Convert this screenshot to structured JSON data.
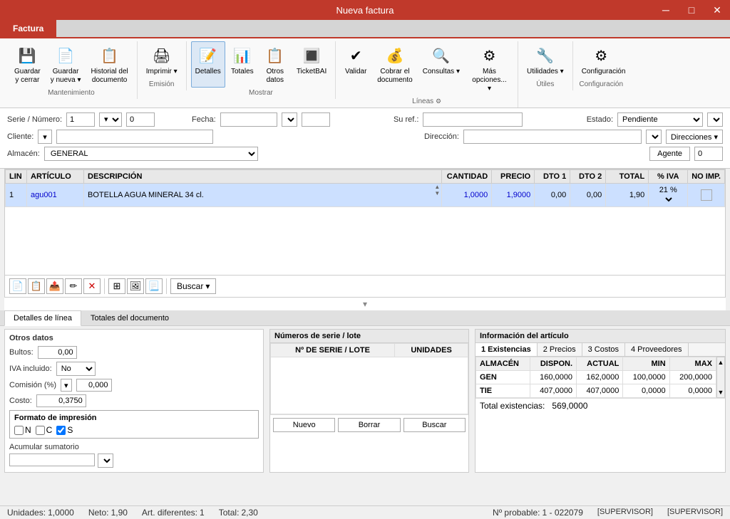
{
  "titleBar": {
    "title": "Nueva factura",
    "minimize": "─",
    "maximize": "□",
    "close": "✕"
  },
  "tab": {
    "label": "Factura"
  },
  "ribbon": {
    "sections": [
      {
        "name": "Mantenimiento",
        "buttons": [
          {
            "id": "guardar-cerrar",
            "label": "Guardar\ny cerrar",
            "icon": "💾"
          },
          {
            "id": "guardar-nueva",
            "label": "Guardar\ny nueva",
            "icon": "📄",
            "dropdown": true
          },
          {
            "id": "historial",
            "label": "Historial del\ndocumento",
            "icon": "📋"
          }
        ]
      },
      {
        "name": "Emisión",
        "buttons": [
          {
            "id": "imprimir",
            "label": "Imprimir",
            "icon": "🖨",
            "dropdown": true
          }
        ]
      },
      {
        "name": "Mostrar",
        "buttons": [
          {
            "id": "detalles",
            "label": "Detalles",
            "icon": "📝",
            "active": true
          },
          {
            "id": "totales",
            "label": "Totales",
            "icon": "📊"
          },
          {
            "id": "otros-datos",
            "label": "Otros\ndatos",
            "icon": "📋"
          },
          {
            "id": "ticketbai",
            "label": "TicketBAI",
            "icon": "🔳"
          }
        ]
      },
      {
        "name": "Líneas",
        "buttons": [
          {
            "id": "validar",
            "label": "Validar",
            "icon": "✔"
          },
          {
            "id": "cobrar",
            "label": "Cobrar el\ndocumento",
            "icon": "💰"
          },
          {
            "id": "consultas",
            "label": "Consultas",
            "icon": "🔍",
            "dropdown": true
          },
          {
            "id": "mas-opciones",
            "label": "Más\nopciones...",
            "icon": "⚙",
            "dropdown": true
          }
        ]
      },
      {
        "name": "Útiles",
        "buttons": [
          {
            "id": "utilidades",
            "label": "Utilidades",
            "icon": "🔧",
            "dropdown": true
          }
        ]
      },
      {
        "name": "Configuración",
        "buttons": [
          {
            "id": "configuracion",
            "label": "Configuración",
            "icon": "⚙"
          }
        ]
      }
    ]
  },
  "form": {
    "serieLabel": "Serie / Número:",
    "serieValue": "1",
    "numeroValue": "0",
    "fechaLabel": "Fecha:",
    "suRefLabel": "Su ref.:",
    "estadoLabel": "Estado:",
    "estadoValue": "Pendiente",
    "clienteLabel": "Cliente:",
    "direccionLabel": "Dirección:",
    "almacenLabel": "Almacén:",
    "almacenValue": "GENERAL",
    "agenteLabel": "Agente",
    "agenteValue": "0"
  },
  "table": {
    "columns": [
      "LIN",
      "ARTÍCULO",
      "DESCRIPCIÓN",
      "CANTIDAD",
      "PRECIO",
      "DTO 1",
      "DTO 2",
      "TOTAL",
      "% IVA",
      "NO IMP."
    ],
    "rows": [
      {
        "lin": "1",
        "articulo": "agu001",
        "descripcion": "BOTELLA AGUA MINERAL 34 cl.",
        "cantidad": "1,0000",
        "precio": "1,9000",
        "dto1": "0,00",
        "dto2": "0,00",
        "total": "1,90",
        "iva": "21 %",
        "noimp": ""
      }
    ]
  },
  "toolbar": {
    "buttons": [
      "📄",
      "📋",
      "📤",
      "✏",
      "✕",
      "🖼",
      "📷",
      "📃"
    ],
    "buscar": "Buscar"
  },
  "detailTabs": [
    {
      "id": "detalles-linea",
      "label": "Detalles de línea",
      "active": true
    },
    {
      "id": "totales-documento",
      "label": "Totales del documento",
      "active": false
    }
  ],
  "lineDetails": {
    "sectionTitle": "Otros datos",
    "bultosLabel": "Bultos:",
    "bultosValue": "0,00",
    "ivaIncluidoLabel": "IVA incluido:",
    "ivaIncluidoValue": "No",
    "costoLabel": "Costo:",
    "costoValue": "0,3750",
    "comisionLabel": "Comisión (%)",
    "comisionValue": "0,000",
    "printFormat": {
      "title": "Formato de impresión",
      "n": {
        "label": "N",
        "checked": false
      },
      "c": {
        "label": "C",
        "checked": false
      },
      "s": {
        "label": "S",
        "checked": true
      }
    },
    "acumularLabel": "Acumular sumatorio",
    "acumularValue": ""
  },
  "seriesPanel": {
    "title": "Números de serie / lote",
    "columns": [
      "Nº DE SERIE / LOTE",
      "UNIDADES"
    ],
    "rows": [],
    "buttons": {
      "nuevo": "Nuevo",
      "borrar": "Borrar",
      "buscar": "Buscar"
    }
  },
  "articleInfo": {
    "title": "Información del artículo",
    "tabs": [
      {
        "id": "existencias",
        "label": "1 Existencias",
        "active": true
      },
      {
        "id": "precios",
        "label": "2 Precios"
      },
      {
        "id": "costos",
        "label": "3 Costos"
      },
      {
        "id": "proveedores",
        "label": "4 Proveedores"
      }
    ],
    "columns": [
      "ALMACÉN",
      "DISPON.",
      "ACTUAL",
      "MIN",
      "MAX"
    ],
    "rows": [
      {
        "almacen": "GEN",
        "dispon": "160,0000",
        "actual": "162,0000",
        "min": "100,0000",
        "max": "200,0000"
      },
      {
        "almacen": "TIE",
        "dispon": "407,0000",
        "actual": "407,0000",
        "min": "0,0000",
        "max": "0,0000"
      }
    ],
    "totalLabel": "Total existencias:",
    "totalValue": "569,0000"
  },
  "statusBar": {
    "unidades": {
      "label": "Unidades:",
      "value": "1,0000"
    },
    "neto": {
      "label": "Neto:",
      "value": "1,90"
    },
    "artDiferentes": {
      "label": "Art. diferentes:",
      "value": "1"
    },
    "total": {
      "label": "Total:",
      "value": "2,30"
    },
    "noProbable": {
      "label": "Nº probable:",
      "value": "1 - 022079"
    },
    "supervisor1": "[SUPERVISOR]",
    "supervisor2": "[SUPERVISOR]"
  }
}
